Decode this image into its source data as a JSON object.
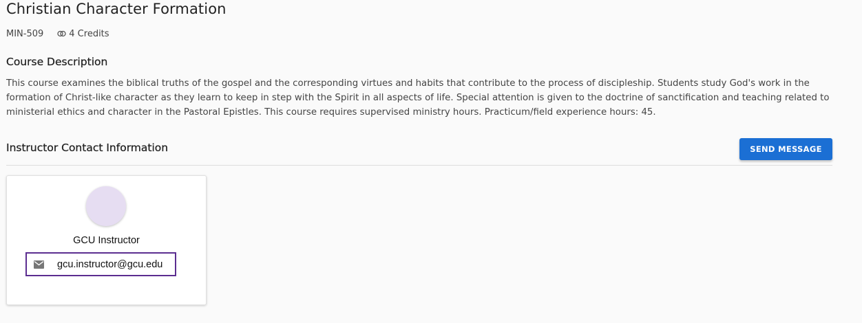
{
  "course": {
    "title": "Christian Character Formation",
    "code": "MIN-509",
    "credits": "4 Credits",
    "credits_icon": "credits-icon"
  },
  "description": {
    "heading": "Course Description",
    "text": "This course examines the biblical truths of the gospel and the corresponding virtues and habits that contribute to the process of discipleship. Students study God's work in the formation of Christ-like character as they learn to keep in step with the Spirit in all aspects of life. Special attention is given to the doctrine of sanctification and teaching related to ministerial ethics and character in the Pastoral Epistles. This course requires supervised ministry hours. Practicum/field experience hours: 45."
  },
  "instructor_section": {
    "heading": "Instructor Contact Information",
    "send_message_label": "SEND MESSAGE"
  },
  "instructor": {
    "name": "GCU Instructor",
    "email": "gcu.instructor@gcu.edu",
    "email_icon": "mail-icon",
    "avatar_color": "#e6ddf2"
  },
  "colors": {
    "accent": "#1b6fd4",
    "focus_outline": "#5b2d90",
    "background": "#fafafa"
  }
}
